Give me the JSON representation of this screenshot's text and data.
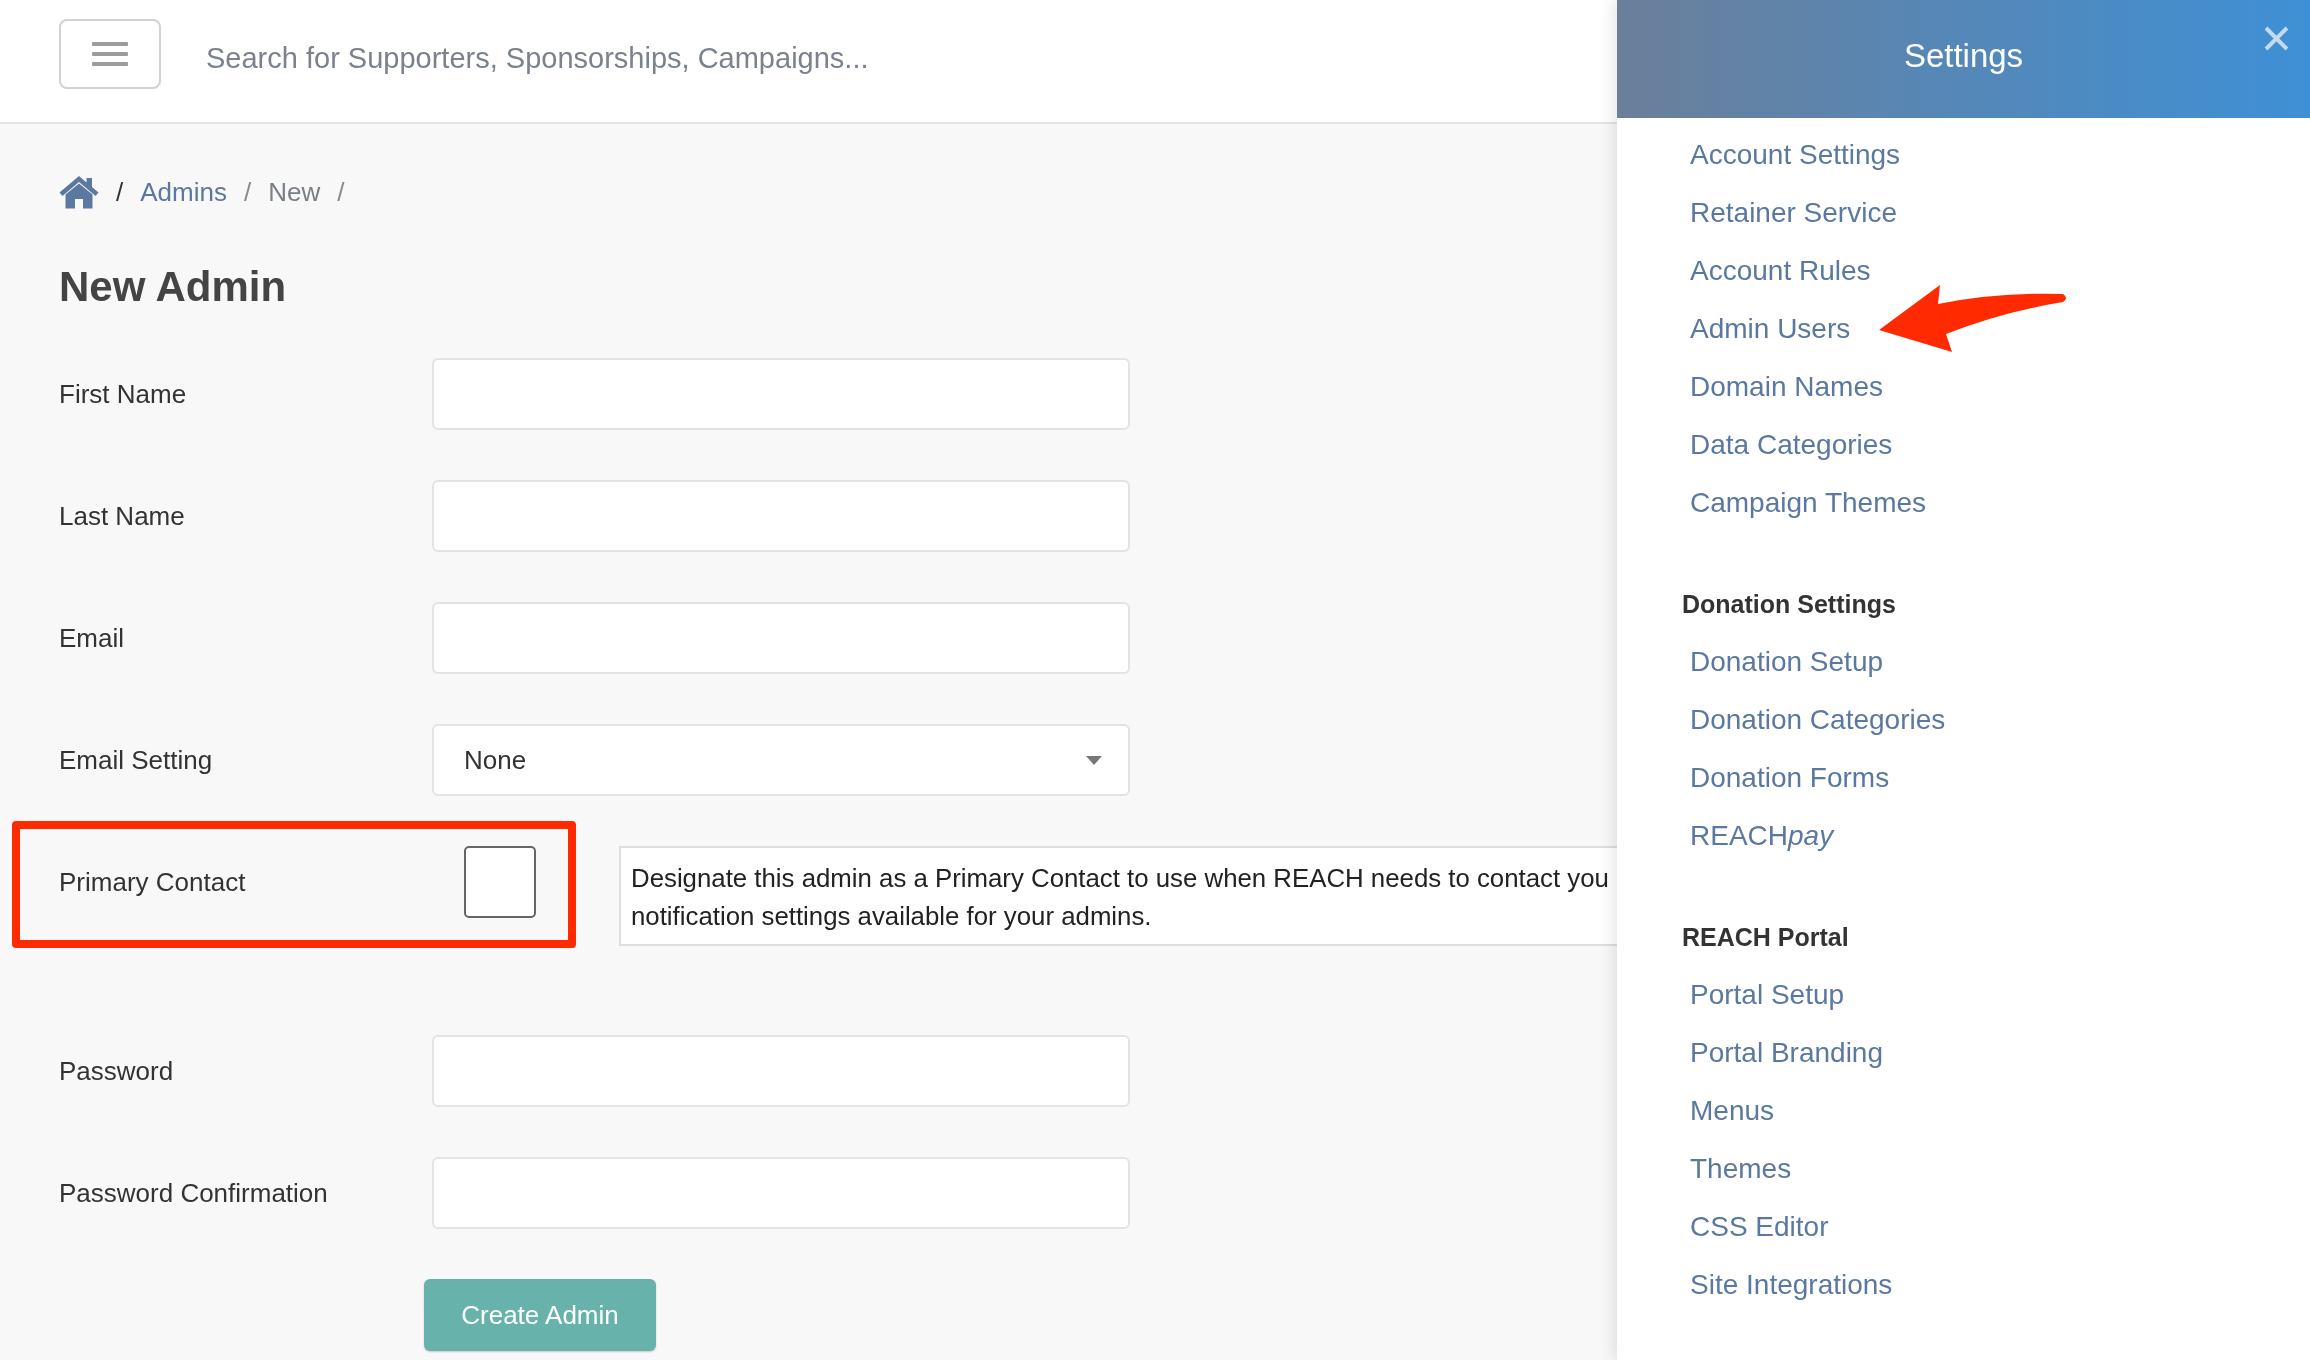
{
  "top_bar": {
    "search": {
      "placeholder": "Search for Supporters, Sponsorships, Campaigns..."
    }
  },
  "breadcrumb": [
    {
      "kind": "home",
      "separator": "/"
    },
    {
      "kind": "link",
      "label": "Admins",
      "separator": "/"
    },
    {
      "kind": "current",
      "label": "New",
      "separator": "/"
    }
  ],
  "page_title": "New Admin",
  "form": {
    "fields": [
      {
        "kind": "text",
        "label": "First Name",
        "highlighted": false
      },
      {
        "kind": "text",
        "label": "Last Name",
        "highlighted": false
      },
      {
        "kind": "text",
        "label": "Email",
        "highlighted": false
      },
      {
        "kind": "select",
        "label": "Email Setting",
        "value": "None",
        "highlighted": false
      },
      {
        "kind": "checkbox",
        "label": "Primary Contact",
        "checked": false,
        "highlighted": true,
        "help_text": [
          "Designate this admin as a Primary Contact to use when REACH needs to contact you",
          "notification settings available for your admins."
        ]
      },
      {
        "kind": "password",
        "label": "Password",
        "highlighted": false
      },
      {
        "kind": "password",
        "label": "Password Confirmation",
        "highlighted": false
      }
    ],
    "submit_button": "Create Admin"
  },
  "settings_panel": {
    "title": "Settings",
    "sections": [
      {
        "items": [
          {
            "label": "Account Settings",
            "pointed_at_by_arrow": false
          },
          {
            "label": "Retainer Service",
            "pointed_at_by_arrow": false
          },
          {
            "label": "Account Rules",
            "pointed_at_by_arrow": false
          },
          {
            "label": "Admin Users",
            "pointed_at_by_arrow": true
          },
          {
            "label": "Domain Names",
            "pointed_at_by_arrow": false
          },
          {
            "label": "Data Categories",
            "pointed_at_by_arrow": false
          },
          {
            "label": "Campaign Themes",
            "pointed_at_by_arrow": false
          }
        ]
      },
      {
        "heading": "Donation Settings",
        "items": [
          {
            "label": "Donation Setup",
            "pointed_at_by_arrow": false
          },
          {
            "label": "Donation Categories",
            "pointed_at_by_arrow": false
          },
          {
            "label": "Donation Forms",
            "pointed_at_by_arrow": false
          },
          {
            "label": "REACH",
            "italic_suffix": "pay",
            "pointed_at_by_arrow": false
          }
        ]
      },
      {
        "heading": "REACH Portal",
        "items": [
          {
            "label": "Portal Setup",
            "pointed_at_by_arrow": false
          },
          {
            "label": "Portal Branding",
            "pointed_at_by_arrow": false
          },
          {
            "label": "Menus",
            "pointed_at_by_arrow": false
          },
          {
            "label": "Themes",
            "pointed_at_by_arrow": false
          },
          {
            "label": "CSS Editor",
            "pointed_at_by_arrow": false
          },
          {
            "label": "Site Integrations",
            "pointed_at_by_arrow": false
          }
        ]
      }
    ]
  }
}
